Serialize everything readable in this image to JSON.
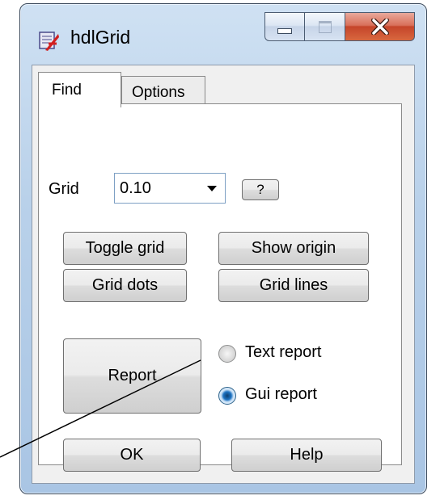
{
  "window": {
    "title": "hdlGrid",
    "app_icon": "hdlgrid-app-icon",
    "caption": {
      "minimize": "minimize-icon",
      "maximize": "maximize-icon",
      "close": "close-icon"
    },
    "close_color": "#c5452a"
  },
  "tabs": [
    {
      "label": "Find",
      "active": true
    },
    {
      "label": "Options",
      "active": false
    }
  ],
  "grid": {
    "label": "Grid",
    "value": "0.10",
    "help_label": "?"
  },
  "buttons": {
    "toggle_grid": "Toggle grid",
    "show_origin": "Show origin",
    "grid_dots": "Grid dots",
    "grid_lines": "Grid lines",
    "report": "Report",
    "ok": "OK",
    "help": "Help"
  },
  "report_options": [
    {
      "label": "Text report",
      "selected": false
    },
    {
      "label": "Gui report",
      "selected": true
    }
  ],
  "colors": {
    "accent": "#1d73c3",
    "window_frame": "#b9d1ea"
  }
}
